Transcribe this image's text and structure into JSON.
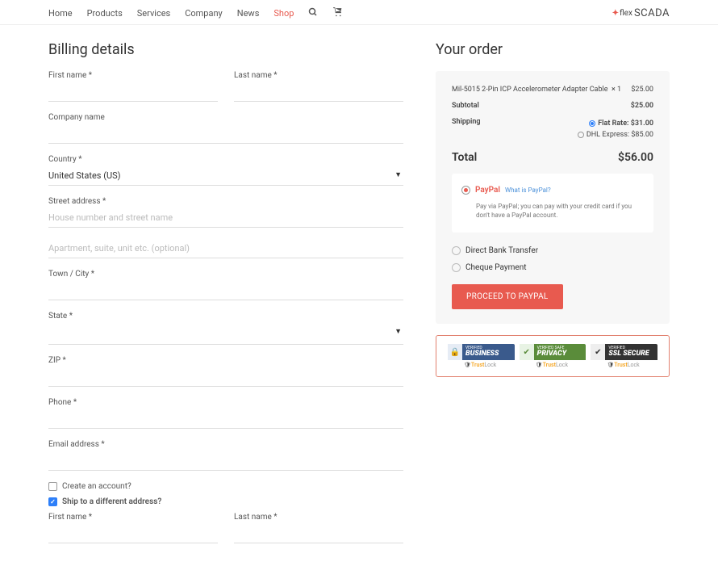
{
  "nav": {
    "items": [
      "Home",
      "Products",
      "Services",
      "Company",
      "News",
      "Shop"
    ],
    "active_index": 5
  },
  "logo": {
    "pre": "flex",
    "main": "SCADA"
  },
  "billing": {
    "heading": "Billing details",
    "first_name_label": "First name *",
    "last_name_label": "Last name *",
    "company_label": "Company name",
    "country_label": "Country *",
    "country_value": "United States (US)",
    "street_label": "Street address *",
    "street_ph": "House number and street name",
    "street2_ph": "Apartment, suite, unit etc. (optional)",
    "town_label": "Town / City *",
    "state_label": "State *",
    "zip_label": "ZIP *",
    "phone_label": "Phone *",
    "email_label": "Email address *",
    "create_account_label": "Create an account?",
    "ship_diff_label": "Ship to a different address?"
  },
  "order": {
    "heading": "Your order",
    "item_name": "Mil-5015 2-Pin ICP Accelerometer Adapter Cable",
    "item_qty": "× 1",
    "item_price": "$25.00",
    "subtotal_label": "Subtotal",
    "subtotal_value": "$25.00",
    "shipping_label": "Shipping",
    "ship_opts": [
      {
        "label": "Flat Rate: $31.00",
        "selected": true
      },
      {
        "label": "DHL Express: $85.00",
        "selected": false
      }
    ],
    "total_label": "Total",
    "total_value": "$56.00",
    "payments": {
      "paypal_label": "PayPal",
      "paypal_link": "What is PayPal?",
      "paypal_desc": "Pay via PayPal; you can pay with your credit card if you don't have a PayPal account.",
      "bank_label": "Direct Bank Transfer",
      "cheque_label": "Cheque Payment"
    },
    "proceed": "PROCEED TO PAYPAL"
  },
  "trust": {
    "badges": [
      {
        "sub": "VERIFIED",
        "main": "BUSINESS"
      },
      {
        "sub": "VERIFIED SAFE",
        "main": "PRIVACY"
      },
      {
        "sub": "VERIFIED",
        "main": "SSL SECURE"
      }
    ],
    "brand_pre": "Trust",
    "brand_post": "Lock"
  }
}
